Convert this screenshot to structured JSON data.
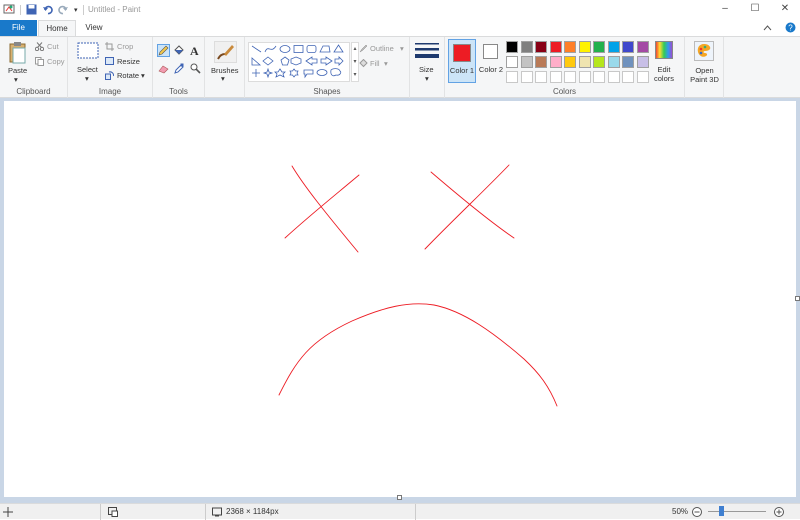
{
  "window": {
    "title": "Untitled - Paint"
  },
  "tabs": {
    "file": "File",
    "home": "Home",
    "view": "View"
  },
  "ribbon": {
    "clipboard": {
      "label": "Clipboard",
      "paste": "Paste",
      "cut": "Cut",
      "copy": "Copy"
    },
    "image": {
      "label": "Image",
      "select": "Select",
      "crop": "Crop",
      "resize": "Resize",
      "rotate": "Rotate"
    },
    "tools": {
      "label": "Tools"
    },
    "brushes": {
      "label": "Brushes"
    },
    "shapes": {
      "label": "Shapes",
      "outline": "Outline",
      "fill": "Fill"
    },
    "size": {
      "label": "Size"
    },
    "colors": {
      "label": "Colors",
      "color1_label": "Color 1",
      "color2_label": "Color 2",
      "color1": "#ed1c24",
      "color2": "#ffffff",
      "palette_row1": [
        "#000000",
        "#7f7f7f",
        "#880015",
        "#ed1c24",
        "#ff7f27",
        "#fff200",
        "#22b14c",
        "#00a2e8",
        "#3f48cc",
        "#a349a4"
      ],
      "palette_row2": [
        "#ffffff",
        "#c3c3c3",
        "#b97a57",
        "#ffaec9",
        "#ffc90e",
        "#efe4b0",
        "#b5e61d",
        "#99d9ea",
        "#7092be",
        "#c8bfe7"
      ],
      "edit_colors": "Edit colors"
    },
    "paint3d": "Open Paint 3D"
  },
  "status": {
    "dimensions": "2368 × 1184px",
    "zoom": "50%"
  }
}
